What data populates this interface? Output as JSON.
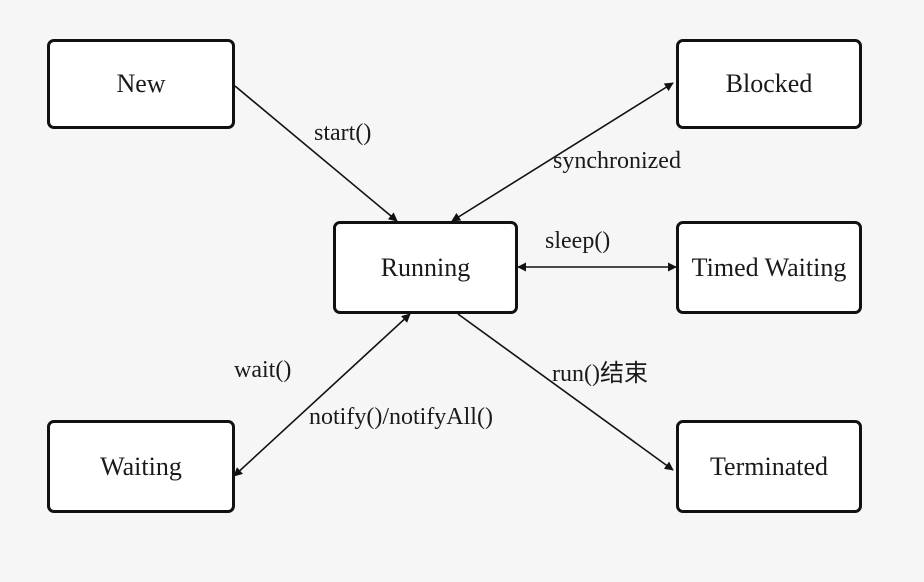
{
  "states": {
    "new": "New",
    "blocked": "Blocked",
    "running": "Running",
    "timed_waiting": "Timed Waiting",
    "waiting": "Waiting",
    "terminated": "Terminated"
  },
  "transitions": {
    "start": "start()",
    "synchronized": "synchronized",
    "sleep": "sleep()",
    "wait": "wait()",
    "notify": "notify()/notifyAll()",
    "run_end": "run()结束"
  },
  "colors": {
    "line": "#111111",
    "box_fill": "#ffffff",
    "background": "#f6f6f6"
  }
}
